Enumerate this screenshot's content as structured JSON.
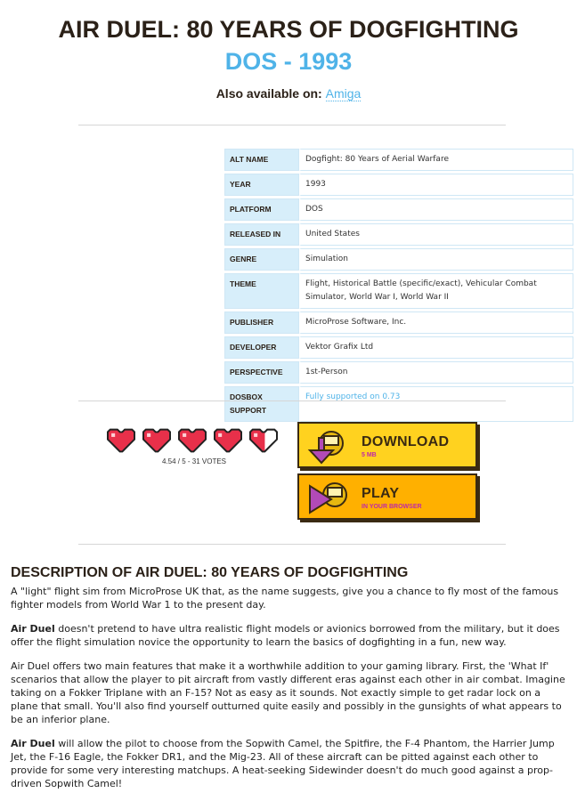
{
  "header": {
    "title": "AIR DUEL: 80 YEARS OF DOGFIGHTING",
    "subtitle": "DOS - 1993",
    "also_label": "Also available on:",
    "also_link": "Amiga"
  },
  "info": [
    {
      "key": "ALT NAME",
      "value": "Dogfight: 80 Years of Aerial Warfare"
    },
    {
      "key": "YEAR",
      "value": "1993"
    },
    {
      "key": "PLATFORM",
      "value": "DOS"
    },
    {
      "key": "RELEASED IN",
      "value": "United States"
    },
    {
      "key": "GENRE",
      "value": "Simulation"
    },
    {
      "key": "THEME",
      "value": "Flight, Historical Battle (specific/exact), Vehicular Combat Simulator, World War I, World War II"
    },
    {
      "key": "PUBLISHER",
      "value": "MicroProse Software, Inc."
    },
    {
      "key": "DEVELOPER",
      "value": "Vektor Grafix Ltd"
    },
    {
      "key": "PERSPECTIVE",
      "value": "1st-Person"
    },
    {
      "key": "DOSBOX SUPPORT",
      "value": "Fully supported on 0.73"
    }
  ],
  "rating": {
    "score": 4.54,
    "max": 5,
    "text": "4.54 / 5 - 31 VOTES",
    "heart_color": "#e8304a"
  },
  "buttons": {
    "download_label": "DOWNLOAD",
    "download_sub": "5 MB",
    "play_label": "PLAY",
    "play_sub": "IN YOUR BROWSER"
  },
  "description": {
    "heading": "DESCRIPTION OF AIR DUEL: 80 YEARS OF DOGFIGHTING",
    "p1": "A \"light\" flight sim from MicroProse UK that, as the name suggests, give you a chance to fly most of the famous fighter models from World War 1 to the present day.",
    "p2_bold": "Air Duel",
    "p2_rest": " doesn't pretend to have ultra realistic flight models or avionics borrowed from the military, but it does offer the flight simulation novice the opportunity to learn the basics of dogfighting in a fun, new way.",
    "p3": "Air Duel offers two main features that make it a worthwhile addition to your gaming library. First, the 'What If' scenarios that allow the player to pit aircraft from vastly different eras against each other in air combat. Imagine taking on a Fokker Triplane with an F-15? Not as easy as it sounds. Not exactly simple to get radar lock on a plane that small. You'll also find yourself outturned quite easily and possibly in the gunsights of what appears to be an inferior plane.",
    "p4_bold": "Air Duel",
    "p4_rest": " will allow the pilot to choose from the Sopwith Camel, the Spitfire, the F-4 Phantom, the Harrier Jump Jet, the F-16 Eagle, the Fokker DR1, and the Mig-23. All of these aircraft can be pitted against each other to provide for some very interesting matchups. A heat-seeking Sidewinder doesn't do much good against a prop-driven Sopwith Camel!"
  }
}
